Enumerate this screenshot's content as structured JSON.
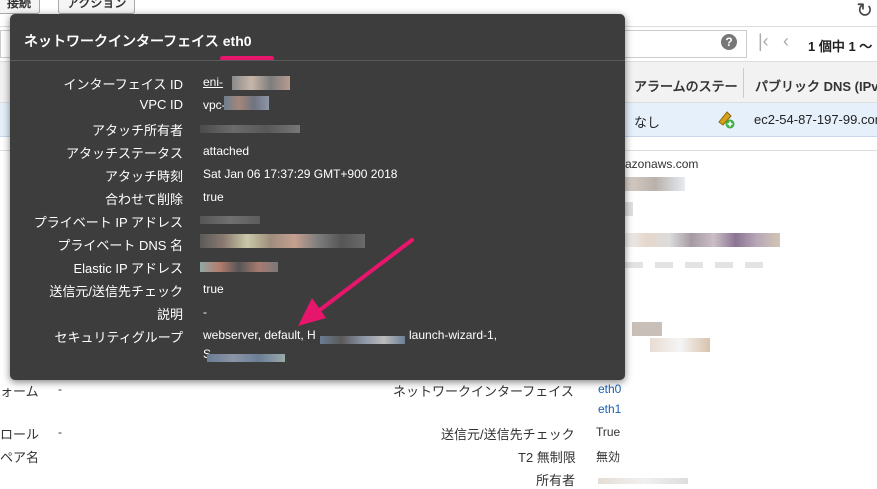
{
  "toolbar": {
    "connect_label": "接続",
    "actions_label": "アクション",
    "refresh_icon": "refresh-icon"
  },
  "search": {
    "help_icon": "?"
  },
  "pager": {
    "first": "⟨",
    "prev": "‹",
    "text": "1 個中 1 〜"
  },
  "table": {
    "headers": [
      "アラームのステー",
      "パブリック DNS (IPv"
    ],
    "row": {
      "alarm": "なし",
      "dns": "ec2-54-87-197-99.com"
    }
  },
  "detail": {
    "domain_fragment": "azonaws.com",
    "left_labels": [
      "ォーム",
      "ロール",
      "ペア名"
    ],
    "left_values": [
      "-",
      "-"
    ],
    "rows": [
      {
        "label": "ネットワークインターフェイス",
        "values": [
          "eth0",
          "eth1"
        ]
      },
      {
        "label": "送信元/送信先チェック",
        "values": [
          "True"
        ]
      },
      {
        "label": "T2 無制限",
        "values": [
          "無効"
        ]
      },
      {
        "label": "所有者",
        "values": []
      }
    ]
  },
  "popup": {
    "title": "ネットワークインターフェイス",
    "iface": "eth0",
    "accent_color": "#e8156d",
    "fields": [
      {
        "label": "インターフェイス ID",
        "value": "eni-"
      },
      {
        "label": "VPC ID",
        "value": "vpc-"
      },
      {
        "label": "アタッチ所有者",
        "value": ""
      },
      {
        "label": "アタッチステータス",
        "value": "attached"
      },
      {
        "label": "アタッチ時刻",
        "value": "Sat Jan 06 17:37:29 GMT+900 2018"
      },
      {
        "label": "合わせて削除",
        "value": "true"
      },
      {
        "label": "プライベート IP アドレス",
        "value": ""
      },
      {
        "label": "プライベート DNS 名",
        "value": ""
      },
      {
        "label": "Elastic IP アドレス",
        "value": ""
      },
      {
        "label": "送信元/送信先チェック",
        "value": "true"
      },
      {
        "label": "説明",
        "value": "-"
      },
      {
        "label": "セキュリティグループ",
        "value": "webserver, default, H",
        "value_tail": "launch-wizard-1,",
        "value_line2": "S"
      }
    ]
  }
}
